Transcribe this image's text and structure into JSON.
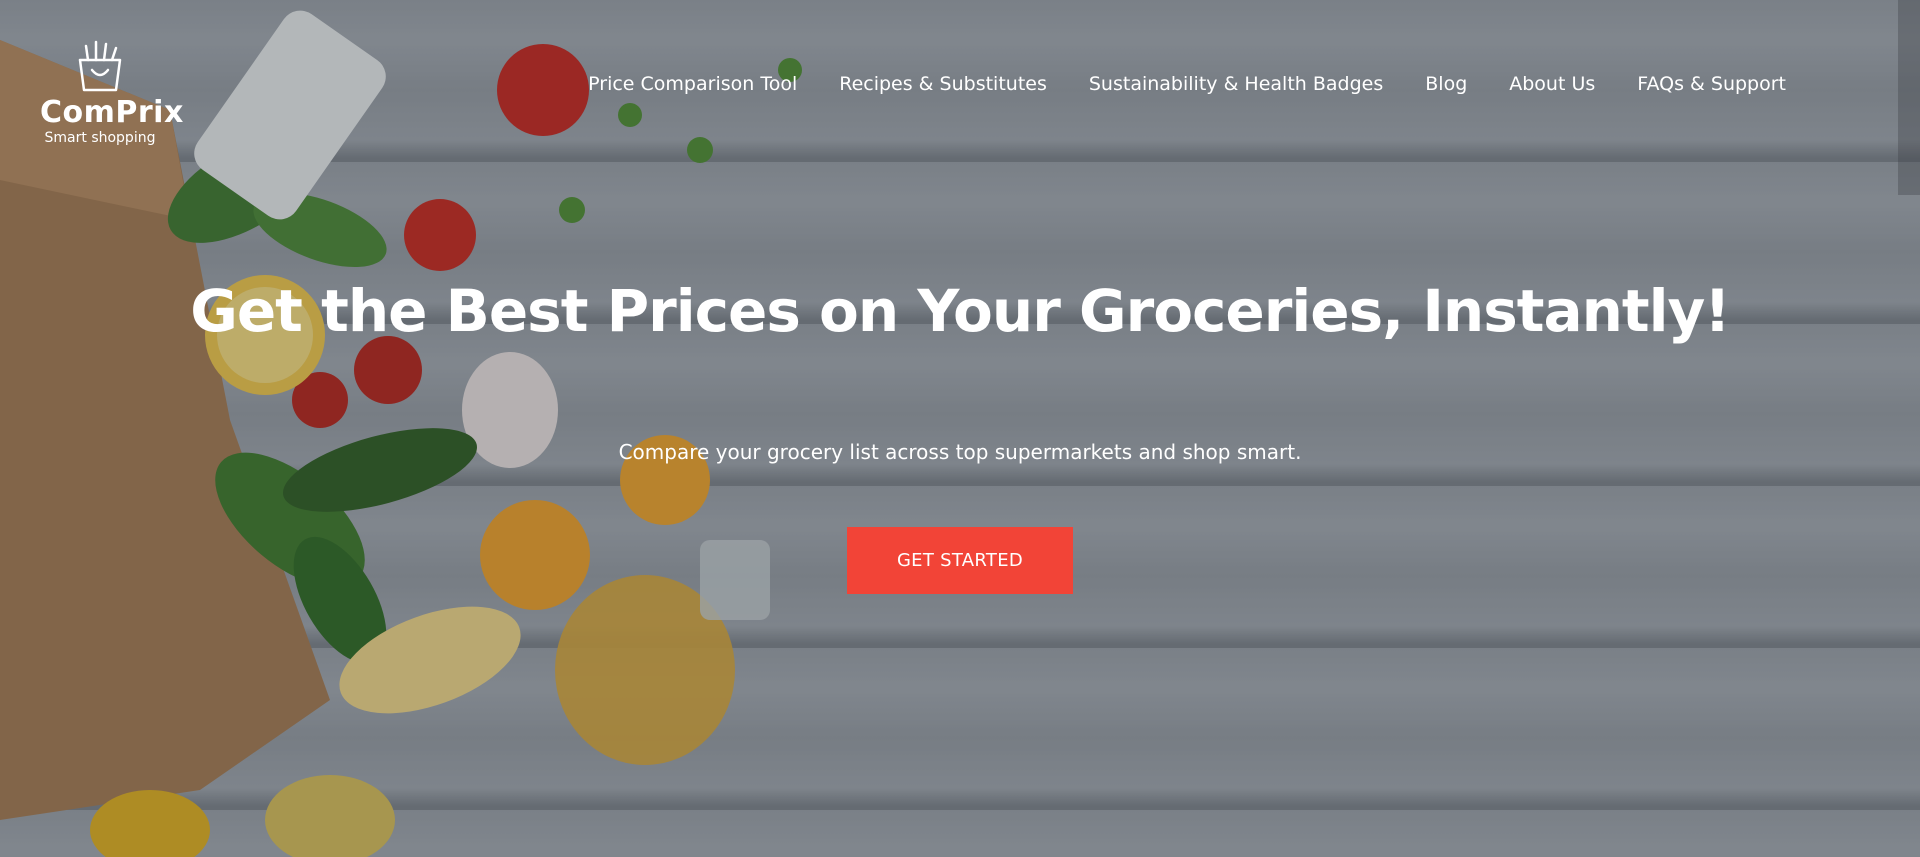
{
  "brand": {
    "name": "ComPrix",
    "tagline": "Smart shopping",
    "logo_icon": "shopping-bag-icon"
  },
  "nav": {
    "items": [
      {
        "label": "Price Comparison Tool"
      },
      {
        "label": "Recipes & Substitutes"
      },
      {
        "label": "Sustainability & Health Badges"
      },
      {
        "label": "Blog"
      },
      {
        "label": "About Us"
      },
      {
        "label": "FAQs & Support"
      }
    ]
  },
  "hero": {
    "headline": "Get the Best Prices on Your Groceries, Instantly!",
    "subheadline": "Compare your grocery list across top supermarkets and shop smart.",
    "cta_label": "GET STARTED"
  },
  "colors": {
    "accent": "#f24437",
    "text": "#ffffff",
    "background": "#9aa1a8"
  }
}
